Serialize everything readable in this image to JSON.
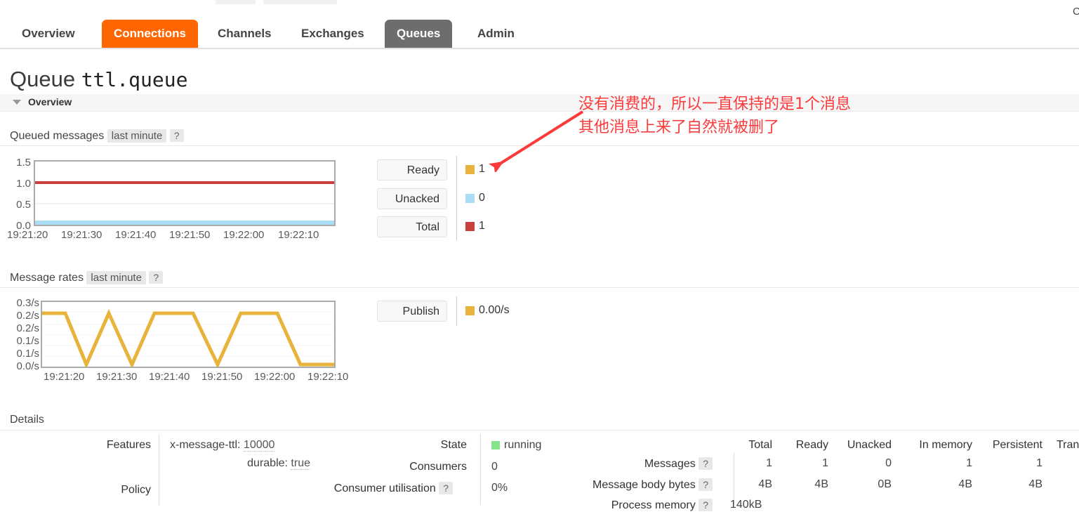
{
  "corner": {
    "partial_text": "C"
  },
  "nav": {
    "tabs": [
      {
        "label": "Overview",
        "state": "normal"
      },
      {
        "label": "Connections",
        "state": "hover"
      },
      {
        "label": "Channels",
        "state": "normal"
      },
      {
        "label": "Exchanges",
        "state": "normal"
      },
      {
        "label": "Queues",
        "state": "active"
      },
      {
        "label": "Admin",
        "state": "normal"
      }
    ],
    "hover_color": "#ff6600",
    "active_color": "#6d6d6d"
  },
  "page": {
    "title_prefix": "Queue",
    "queue_name": "ttl.queue"
  },
  "overview_section": {
    "label": "Overview"
  },
  "queued_messages": {
    "title": "Queued messages",
    "period_chip": "last minute",
    "help_chip": "?",
    "legend": [
      {
        "name": "Ready",
        "value": "1",
        "color": "#e8b33a"
      },
      {
        "name": "Unacked",
        "value": "0",
        "color": "#aadcf5"
      },
      {
        "name": "Total",
        "value": "1",
        "color": "#c9403c"
      }
    ]
  },
  "message_rates": {
    "title": "Message rates",
    "period_chip": "last minute",
    "help_chip": "?",
    "legend": [
      {
        "name": "Publish",
        "value": "0.00/s",
        "color": "#e8b33a"
      }
    ]
  },
  "chart_data": [
    {
      "type": "line",
      "title": "Queued messages",
      "xlabel": "",
      "ylabel": "",
      "ylim": [
        0.0,
        1.5
      ],
      "yticks": [
        "0.0",
        "0.5",
        "1.0",
        "1.5"
      ],
      "xticks": [
        "19:21:20",
        "19:21:30",
        "19:21:40",
        "19:21:50",
        "19:22:00",
        "19:22:10"
      ],
      "grid": true,
      "legend_position": "right",
      "series": [
        {
          "name": "Total",
          "color": "#c9403c",
          "values": [
            1,
            1,
            1,
            1,
            1,
            1,
            1,
            1,
            1,
            1,
            1,
            1,
            1
          ]
        },
        {
          "name": "Ready",
          "color": "#e8b33a",
          "values": [
            1,
            1,
            1,
            1,
            1,
            1,
            1,
            1,
            1,
            1,
            1,
            1,
            1
          ]
        },
        {
          "name": "Unacked",
          "color": "#aadcf5",
          "values": [
            0,
            0,
            0,
            0,
            0,
            0,
            0,
            0,
            0,
            0,
            0,
            0,
            0
          ]
        }
      ]
    },
    {
      "type": "line",
      "title": "Message rates",
      "xlabel": "",
      "ylabel": "",
      "ylim": [
        0.0,
        0.3
      ],
      "yticks": [
        "0.3/s",
        "0.2/s",
        "0.2/s",
        "0.1/s",
        "0.1/s",
        "0.0/s"
      ],
      "xticks": [
        "19:21:20",
        "19:21:30",
        "19:21:40",
        "19:21:50",
        "19:22:00",
        "19:22:10"
      ],
      "grid": true,
      "legend_position": "right",
      "series": [
        {
          "name": "Publish",
          "color": "#e8b33a",
          "x": [
            0,
            8,
            16,
            24,
            32,
            40,
            48,
            54,
            62,
            70,
            78,
            86,
            94,
            100
          ],
          "values": [
            0.2,
            0.2,
            0.0,
            0.2,
            0.0,
            0.2,
            0.2,
            0.0,
            0.2,
            0.2,
            0.0,
            0.0,
            0.0,
            0.0
          ]
        }
      ]
    }
  ],
  "annotation": {
    "line1": "没有消费的，所以一直保持的是1个消息",
    "line2": "其他消息上来了自然就被删了",
    "color": "#fb3b3b"
  },
  "details": {
    "title": "Details",
    "left": {
      "features_label": "Features",
      "features": [
        {
          "key": "x-message-ttl:",
          "value": "10000"
        },
        {
          "key": "durable:",
          "value": "true"
        }
      ],
      "policy_label": "Policy",
      "policy_value": ""
    },
    "middle": [
      {
        "label": "State",
        "value": "running",
        "dot_color": "#86e58a"
      },
      {
        "label": "Consumers",
        "value": "0"
      },
      {
        "label": "Consumer utilisation",
        "help": "?",
        "value": "0%"
      }
    ],
    "table": {
      "columns": [
        "Total",
        "Ready",
        "Unacked",
        "In memory",
        "Persistent",
        "Tran"
      ],
      "rows": [
        {
          "label": "Messages",
          "help": "?",
          "cells": [
            "1",
            "1",
            "0",
            "1",
            "1",
            ""
          ]
        },
        {
          "label": "Message body bytes",
          "help": "?",
          "cells": [
            "4B",
            "4B",
            "0B",
            "4B",
            "4B",
            ""
          ]
        },
        {
          "label": "Process memory",
          "help": "?",
          "cells": [
            "140kB",
            "",
            "",
            "",
            "",
            ""
          ]
        }
      ]
    }
  }
}
